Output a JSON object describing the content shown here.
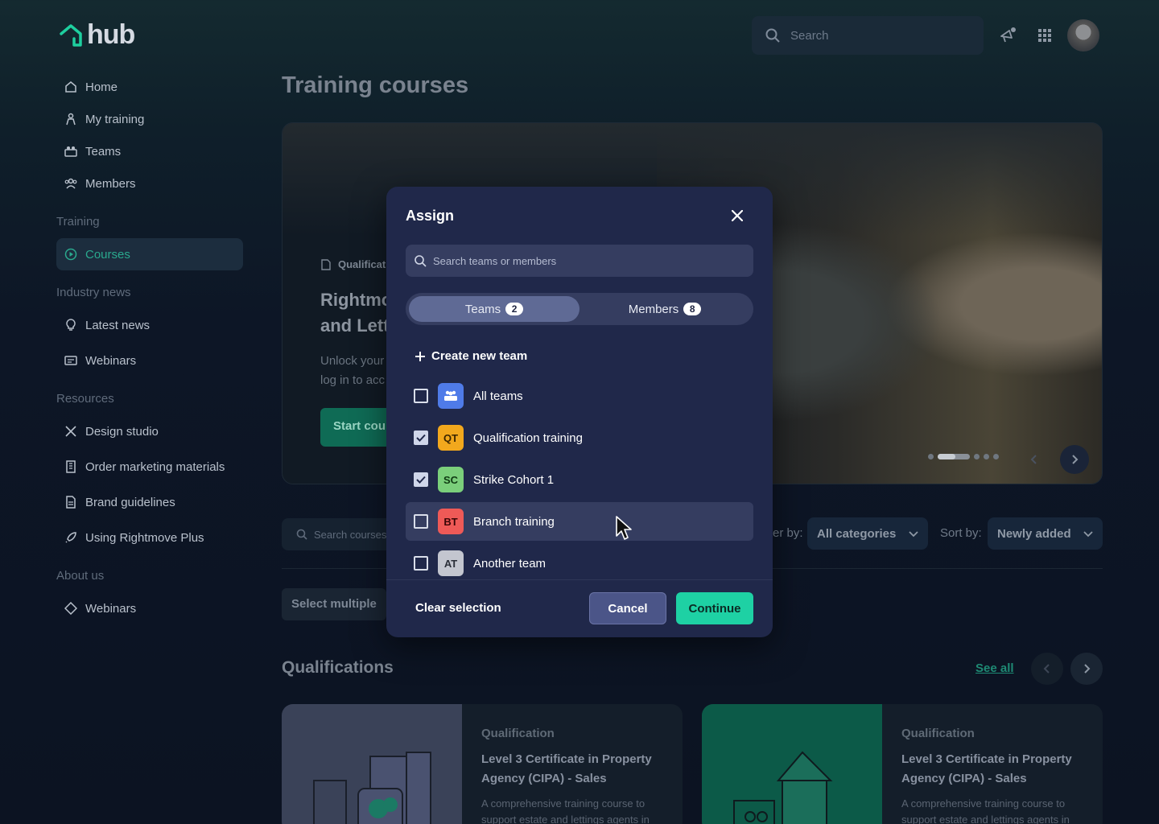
{
  "app": {
    "logo_text": "hub"
  },
  "header": {
    "search_placeholder": "Search"
  },
  "sidebar": {
    "items": [
      {
        "label": "Home",
        "icon": "home-icon"
      },
      {
        "label": "My training",
        "icon": "person-icon"
      },
      {
        "label": "Teams",
        "icon": "teams-icon"
      },
      {
        "label": "Members",
        "icon": "members-icon"
      }
    ],
    "section_training": "Training",
    "courses": "Courses",
    "section_news": "Industry news",
    "latest_news": "Latest news",
    "webinars": "Webinars",
    "section_resources": "Resources",
    "resources": [
      "Design studio",
      "Order marketing materials",
      "Brand guidelines",
      "Using Rightmove Plus"
    ],
    "section_about": "About us",
    "about_webinars": "Webinars"
  },
  "main": {
    "title": "Training courses",
    "hero": {
      "tag": "Qualificat",
      "title_line1": "Rightmo",
      "title_line2": "and Lett",
      "desc_line1": "Unlock your",
      "desc_line2": "log in to acc",
      "button": "Start cou"
    },
    "filter": {
      "search_placeholder": "Search courses",
      "filter_label": "er by:",
      "category_value": "All categories",
      "sort_label": "Sort by:",
      "sort_value": "Newly added"
    },
    "select_multiple": "Select multiple",
    "qualifications": {
      "title": "Qualifications",
      "see_all": "See all",
      "cards": [
        {
          "tag": "Qualification",
          "title": "Level 3 Certificate in Property Agency (CIPA) - Sales",
          "desc": "A comprehensive training course to support estate and lettings agents in"
        },
        {
          "tag": "Qualification",
          "title": "Level 3 Certificate in Property Agency (CIPA) - Sales",
          "desc": "A comprehensive training course to support estate and lettings agents in"
        }
      ]
    }
  },
  "modal": {
    "title": "Assign",
    "search_placeholder": "Search teams or members",
    "tabs": [
      {
        "label": "Teams",
        "count": "2"
      },
      {
        "label": "Members",
        "count": "8"
      }
    ],
    "create_team": "Create new team",
    "teams": [
      {
        "name": "All teams",
        "initials": "",
        "checked": false,
        "color": "#4f7be8"
      },
      {
        "name": "Qualification training",
        "initials": "QT",
        "checked": true,
        "color": "#f2a81d"
      },
      {
        "name": "Strike Cohort 1",
        "initials": "SC",
        "checked": true,
        "color": "#7bcf7b"
      },
      {
        "name": "Branch training",
        "initials": "BT",
        "checked": false,
        "color": "#ef5a57"
      },
      {
        "name": "Another team",
        "initials": "AT",
        "checked": false,
        "color": "#c3c6cf"
      }
    ],
    "clear": "Clear selection",
    "cancel": "Cancel",
    "continue": "Continue"
  }
}
